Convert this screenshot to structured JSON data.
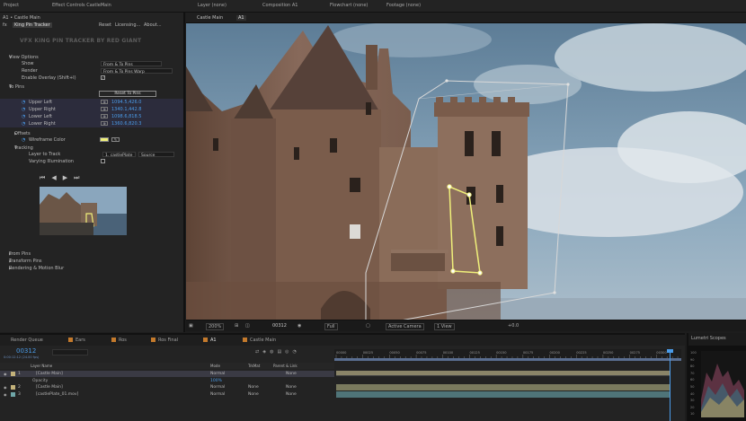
{
  "top_tabs": {
    "project": "Project",
    "effect_controls": "Effect Controls CastleMain",
    "layer": "Layer (none)",
    "composition": "Composition A1",
    "flowchart": "Flowchart (none)",
    "footage": "Footage (none)"
  },
  "effect_panel": {
    "breadcrumb": "A1 • Castle Main",
    "fx_name": "King Pin Tracker",
    "reset": "Reset",
    "licensing": "Licensing...",
    "about": "About...",
    "logo_text": "VFX KING PIN TRACKER BY RED GIANT",
    "view_options": "View Options",
    "show_label": "Show",
    "show_value": "From & To Pins",
    "render_label": "Render",
    "render_value": "From & To Pins Warp",
    "enable_overlay": "Enable Overlay (Shift+I)",
    "enable_overlay_checked": "✓",
    "to_pins": "To Pins",
    "reset_to_pins": "Reset To Pins",
    "upper_left": "Upper Left",
    "upper_left_val": "1094.5,426.0",
    "upper_right": "Upper Right",
    "upper_right_val": "1340.1,442.8",
    "lower_left": "Lower Left",
    "lower_left_val": "1098.6,818.5",
    "lower_right": "Lower Right",
    "lower_right_val": "1360.6,820.3",
    "offsets": "Offsets",
    "wireframe_color": "Wireframe Color",
    "wireframe_hex": "#f0f07a",
    "tracking": "Tracking",
    "layer_to_track": "Layer to Track",
    "layer_to_track_value": "1. castlePlate",
    "source": "Source",
    "varying_illumination": "Varying Illumination",
    "from_pins": "From Pins",
    "transform_pins": "Transform Pins",
    "rendering_motion_blur": "Rendering & Motion Blur"
  },
  "viewer": {
    "comp_tab": "Castle Main",
    "layer_tab": "A1",
    "zoom": "200%",
    "timecode": "00312",
    "quality": "Full",
    "camera": "Active Camera",
    "views": "1 View",
    "exposure": "+0.0"
  },
  "timeline": {
    "tabs": [
      "Render Queue",
      "Ears",
      "Ros",
      "Ros Final",
      "A1",
      "Castle Main"
    ],
    "tab_colors": [
      "#3a3a3a",
      "#c47a2c",
      "#c47a2c",
      "#c47a2c",
      "#c47a2c",
      "#c47a2c"
    ],
    "timecode": "00312",
    "timecode_sub": "0:00:12:12 (24.00 fps)",
    "col_layer_name": "Layer Name",
    "col_mode": "Mode",
    "col_trkmat": "TrkMat",
    "col_parent": "Parent & Link",
    "ruler": [
      "00000",
      "00025",
      "00050",
      "00075",
      "00100",
      "00125",
      "00150",
      "00175",
      "00200",
      "00225",
      "00250",
      "00275",
      "00300"
    ],
    "layers": [
      {
        "num": "1",
        "name": "[Castle Main]",
        "mode": "Normal",
        "trkmat": "",
        "parent": "None",
        "color": "#c3b27a"
      },
      {
        "num": "",
        "name": "Opacity",
        "mode": "100%",
        "trkmat": "",
        "parent": "",
        "color": ""
      },
      {
        "num": "2",
        "name": "[Castle Main]",
        "mode": "Normal",
        "trkmat": "None",
        "parent": "None",
        "color": "#c3b27a"
      },
      {
        "num": "3",
        "name": "[castlePlate_01.mov]",
        "mode": "Normal",
        "trkmat": "None",
        "parent": "None",
        "color": "#6fa6a8"
      }
    ]
  },
  "lumetri": {
    "title": "Lumetri Scopes",
    "scale": [
      "100",
      "90",
      "80",
      "70",
      "60",
      "50",
      "40",
      "30",
      "20",
      "10"
    ]
  }
}
